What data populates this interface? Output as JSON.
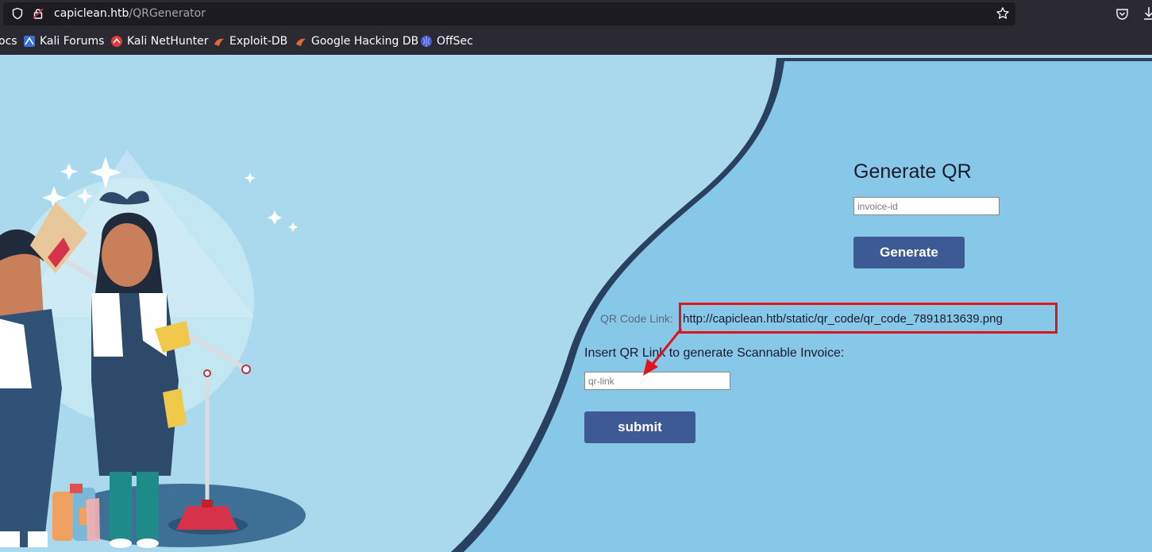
{
  "browser": {
    "url_host": "capiclean.htb",
    "url_path": "/QRGenerator",
    "bookmarks": [
      {
        "label": "ocs",
        "icon": "bookmark-icon"
      },
      {
        "label": "Kali Forums",
        "icon": "kali-forums-icon"
      },
      {
        "label": "Kali NetHunter",
        "icon": "kali-nethunter-icon"
      },
      {
        "label": "Exploit-DB",
        "icon": "exploit-db-icon"
      },
      {
        "label": "Google Hacking DB",
        "icon": "ghdb-icon"
      },
      {
        "label": "OffSec",
        "icon": "offsec-icon"
      }
    ]
  },
  "page": {
    "title": "Generate QR",
    "invoice_placeholder": "invoice-id",
    "generate_label": "Generate",
    "qr_code_label": "QR Code Link:",
    "qr_code_link": "http://capiclean.htb/static/qr_code/qr_code_7891813639.png",
    "insert_label": "Insert QR Link to generate Scannable Invoice:",
    "qr_link_placeholder": "qr-link",
    "submit_label": "submit"
  },
  "colors": {
    "accent_button": "#3e5a94",
    "highlight": "#e0151a",
    "background_light": "#aad9ee",
    "background_panel": "#87c8e8"
  }
}
